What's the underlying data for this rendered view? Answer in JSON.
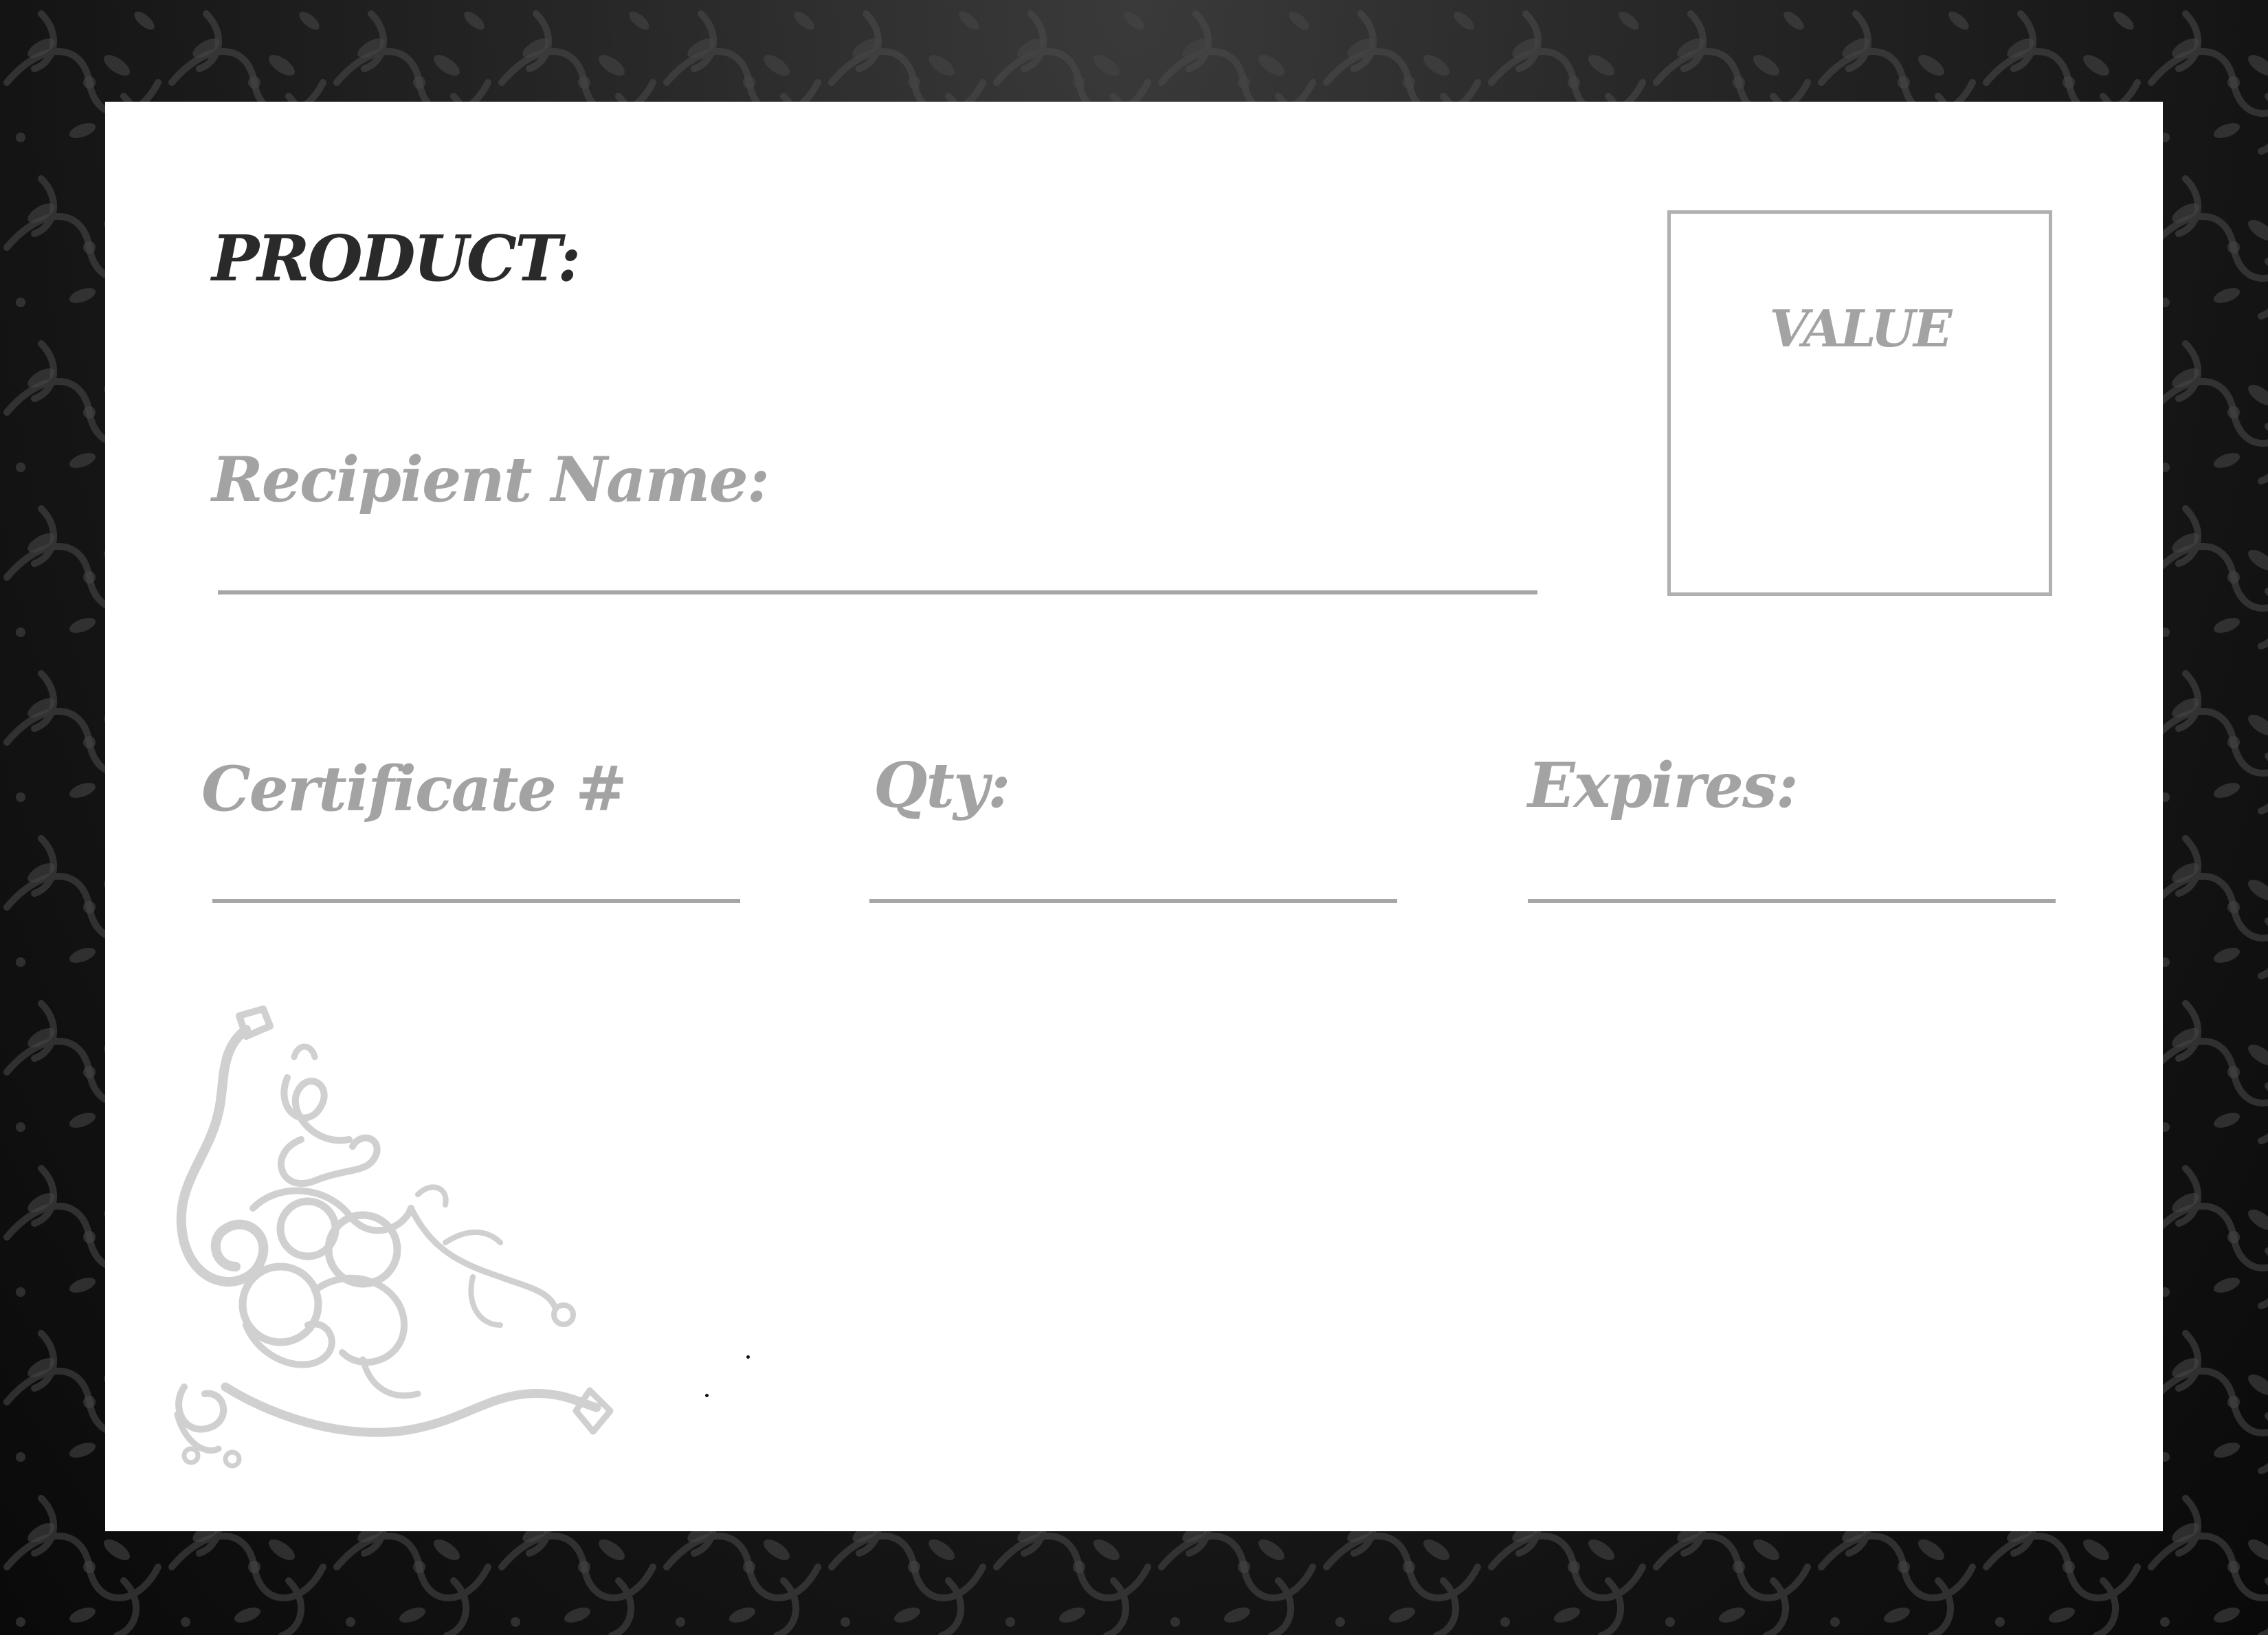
{
  "certificate": {
    "product_label": "PRODUCT:",
    "recipient_label": "Recipient Name:",
    "value_label": "VALUE",
    "certificate_label": "Certificate #",
    "qty_label": "Qty:",
    "expires_label": "Expires:"
  },
  "colors": {
    "border_background": "#1a1a1a",
    "card_background": "#ffffff",
    "heading_text": "#2a2a2a",
    "label_text": "#a3a3a3",
    "rule_lines": "#a6a6a6",
    "ornament": "#cfcfcf"
  },
  "decorations": {
    "border_pattern": "floral-damask-pattern",
    "corner_ornament": "corner-flourish-ornament"
  }
}
